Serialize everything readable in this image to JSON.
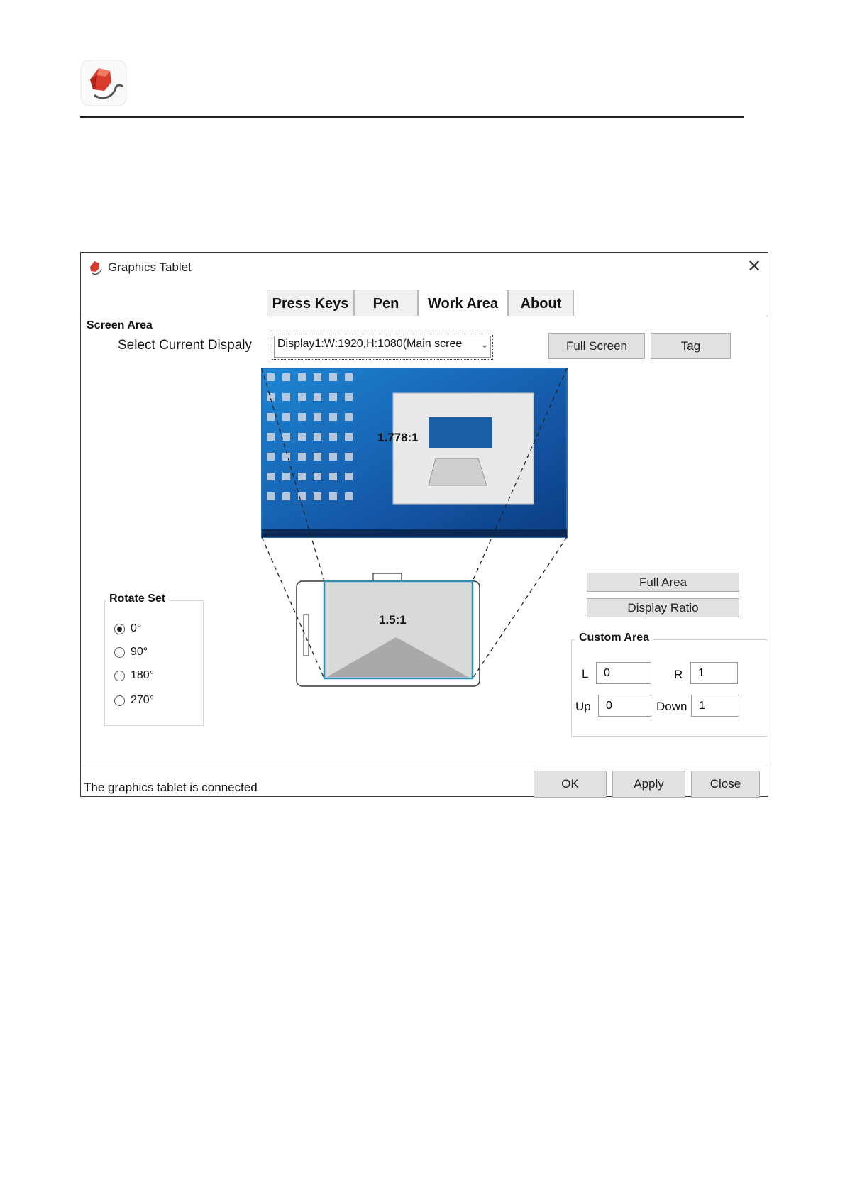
{
  "window": {
    "title": "Graphics Tablet",
    "close_icon": "close-icon",
    "tabs": [
      {
        "label": "Press Keys",
        "active": false
      },
      {
        "label": "Pen",
        "active": false
      },
      {
        "label": "Work Area",
        "active": true
      },
      {
        "label": "About",
        "active": false
      }
    ]
  },
  "screen_area": {
    "title": "Screen Area",
    "select_label": "Select Current Dispaly",
    "display_value": "Display1:W:1920,H:1080(Main scree",
    "full_screen_label": "Full Screen",
    "tag_label": "Tag",
    "screen_ratio": "1.778:1"
  },
  "tablet": {
    "ratio": "1.5:1"
  },
  "rotate": {
    "title": "Rotate Set",
    "options": [
      "0°",
      "90°",
      "180°",
      "270°"
    ],
    "selected": "0°"
  },
  "area_buttons": {
    "full_area_label": "Full Area",
    "display_ratio_label": "Display Ratio"
  },
  "custom_area": {
    "title": "Custom Area",
    "l_label": "L",
    "l_value": "0",
    "r_label": "R",
    "r_value": "1",
    "up_label": "Up",
    "up_value": "0",
    "down_label": "Down",
    "down_value": "1"
  },
  "footer": {
    "status": "The graphics tablet is connected",
    "ok_label": "OK",
    "apply_label": "Apply",
    "close_label": "Close"
  },
  "colors": {
    "desktop_blue": "#1565b8",
    "selection_border": "#2f8fb4",
    "button_face": "#e1e1e1"
  }
}
